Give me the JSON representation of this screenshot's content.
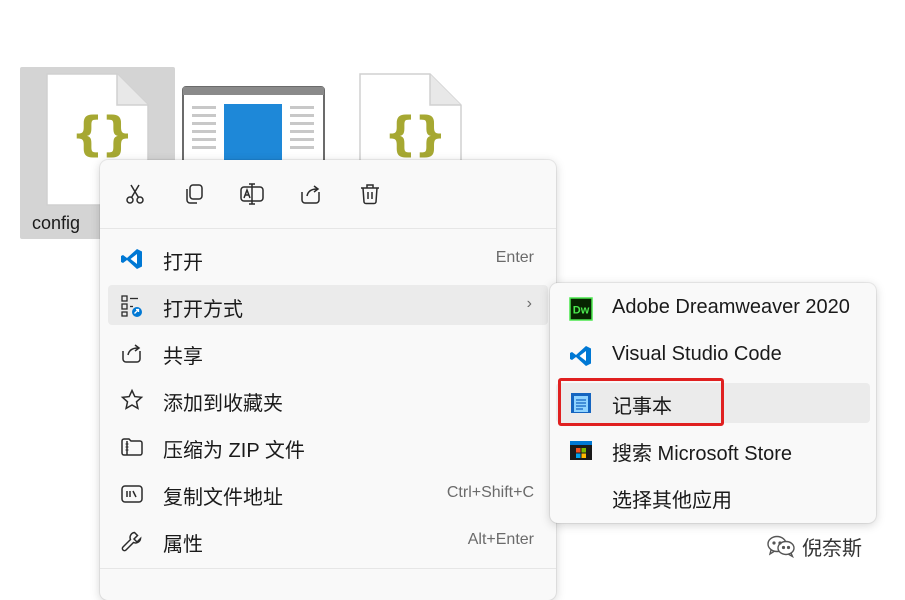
{
  "desktop": {
    "selected_file_name": "config"
  },
  "context_menu": {
    "toolbar": [
      {
        "name": "cut-button",
        "icon": "cut-icon"
      },
      {
        "name": "copy-button",
        "icon": "copy-icon"
      },
      {
        "name": "rename-button",
        "icon": "rename-icon"
      },
      {
        "name": "share-button",
        "icon": "share-icon"
      },
      {
        "name": "delete-button",
        "icon": "trash-icon"
      }
    ],
    "items": [
      {
        "label": "打开",
        "shortcut": "Enter",
        "icon": "vscode-icon"
      },
      {
        "label": "打开方式",
        "shortcut": "",
        "icon": "open-with-icon",
        "has_submenu": true,
        "arrow": "›"
      },
      {
        "label": "共享",
        "shortcut": "",
        "icon": "share-icon"
      },
      {
        "label": "添加到收藏夹",
        "shortcut": "",
        "icon": "star-icon"
      },
      {
        "label": "压缩为 ZIP 文件",
        "shortcut": "",
        "icon": "zip-folder-icon"
      },
      {
        "label": "复制文件地址",
        "shortcut": "Ctrl+Shift+C",
        "icon": "copy-path-icon"
      },
      {
        "label": "属性",
        "shortcut": "Alt+Enter",
        "icon": "wrench-icon"
      }
    ]
  },
  "submenu": {
    "items": [
      {
        "label": "Adobe Dreamweaver 2020",
        "icon": "dreamweaver-icon",
        "icon_text": "Dw"
      },
      {
        "label": "Visual Studio Code",
        "icon": "vscode-icon"
      },
      {
        "label": "记事本",
        "icon": "notepad-icon"
      },
      {
        "label": "搜索 Microsoft Store",
        "icon": "microsoft-store-icon"
      },
      {
        "label": "选择其他应用",
        "icon": ""
      }
    ]
  },
  "watermark": {
    "text": "倪奈斯"
  },
  "colors": {
    "accent": "#0078d4",
    "highlight": "#e02020",
    "json_brace": "#a6a832"
  }
}
